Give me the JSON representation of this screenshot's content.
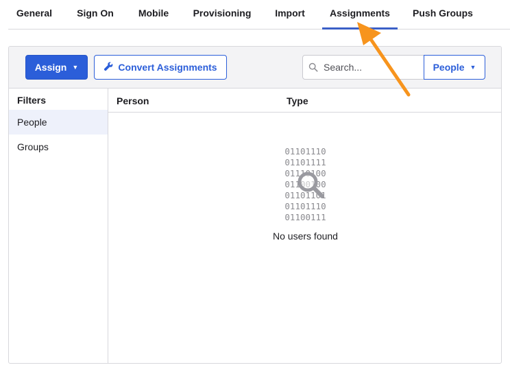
{
  "tabs": [
    {
      "label": "General"
    },
    {
      "label": "Sign On"
    },
    {
      "label": "Mobile"
    },
    {
      "label": "Provisioning"
    },
    {
      "label": "Import"
    },
    {
      "label": "Assignments",
      "active": true
    },
    {
      "label": "Push Groups"
    }
  ],
  "toolbar": {
    "assign_label": "Assign",
    "assign_caret": "▼",
    "convert_label": "Convert Assignments",
    "convert_icon": "wrench-icon",
    "search_placeholder": "Search...",
    "search_icon": "search-icon",
    "filter_select_value": "People",
    "filter_select_caret": "▼"
  },
  "filters": {
    "title": "Filters",
    "items": [
      {
        "label": "People",
        "selected": true
      },
      {
        "label": "Groups",
        "selected": false
      }
    ]
  },
  "table": {
    "columns": [
      "Person",
      "Type"
    ],
    "empty_state": {
      "binary_lines": [
        "01101110",
        "01101111",
        "01110100",
        "01100100",
        "01101101",
        "01101110",
        "01100111"
      ],
      "icon": "magnifier-icon",
      "message": "No users found"
    }
  },
  "colors": {
    "accent": "#2b5ed9",
    "tab_underline": "#3b5fc7",
    "annotation_arrow": "#f7941d",
    "selected_filter_bg": "#eef1fb"
  }
}
